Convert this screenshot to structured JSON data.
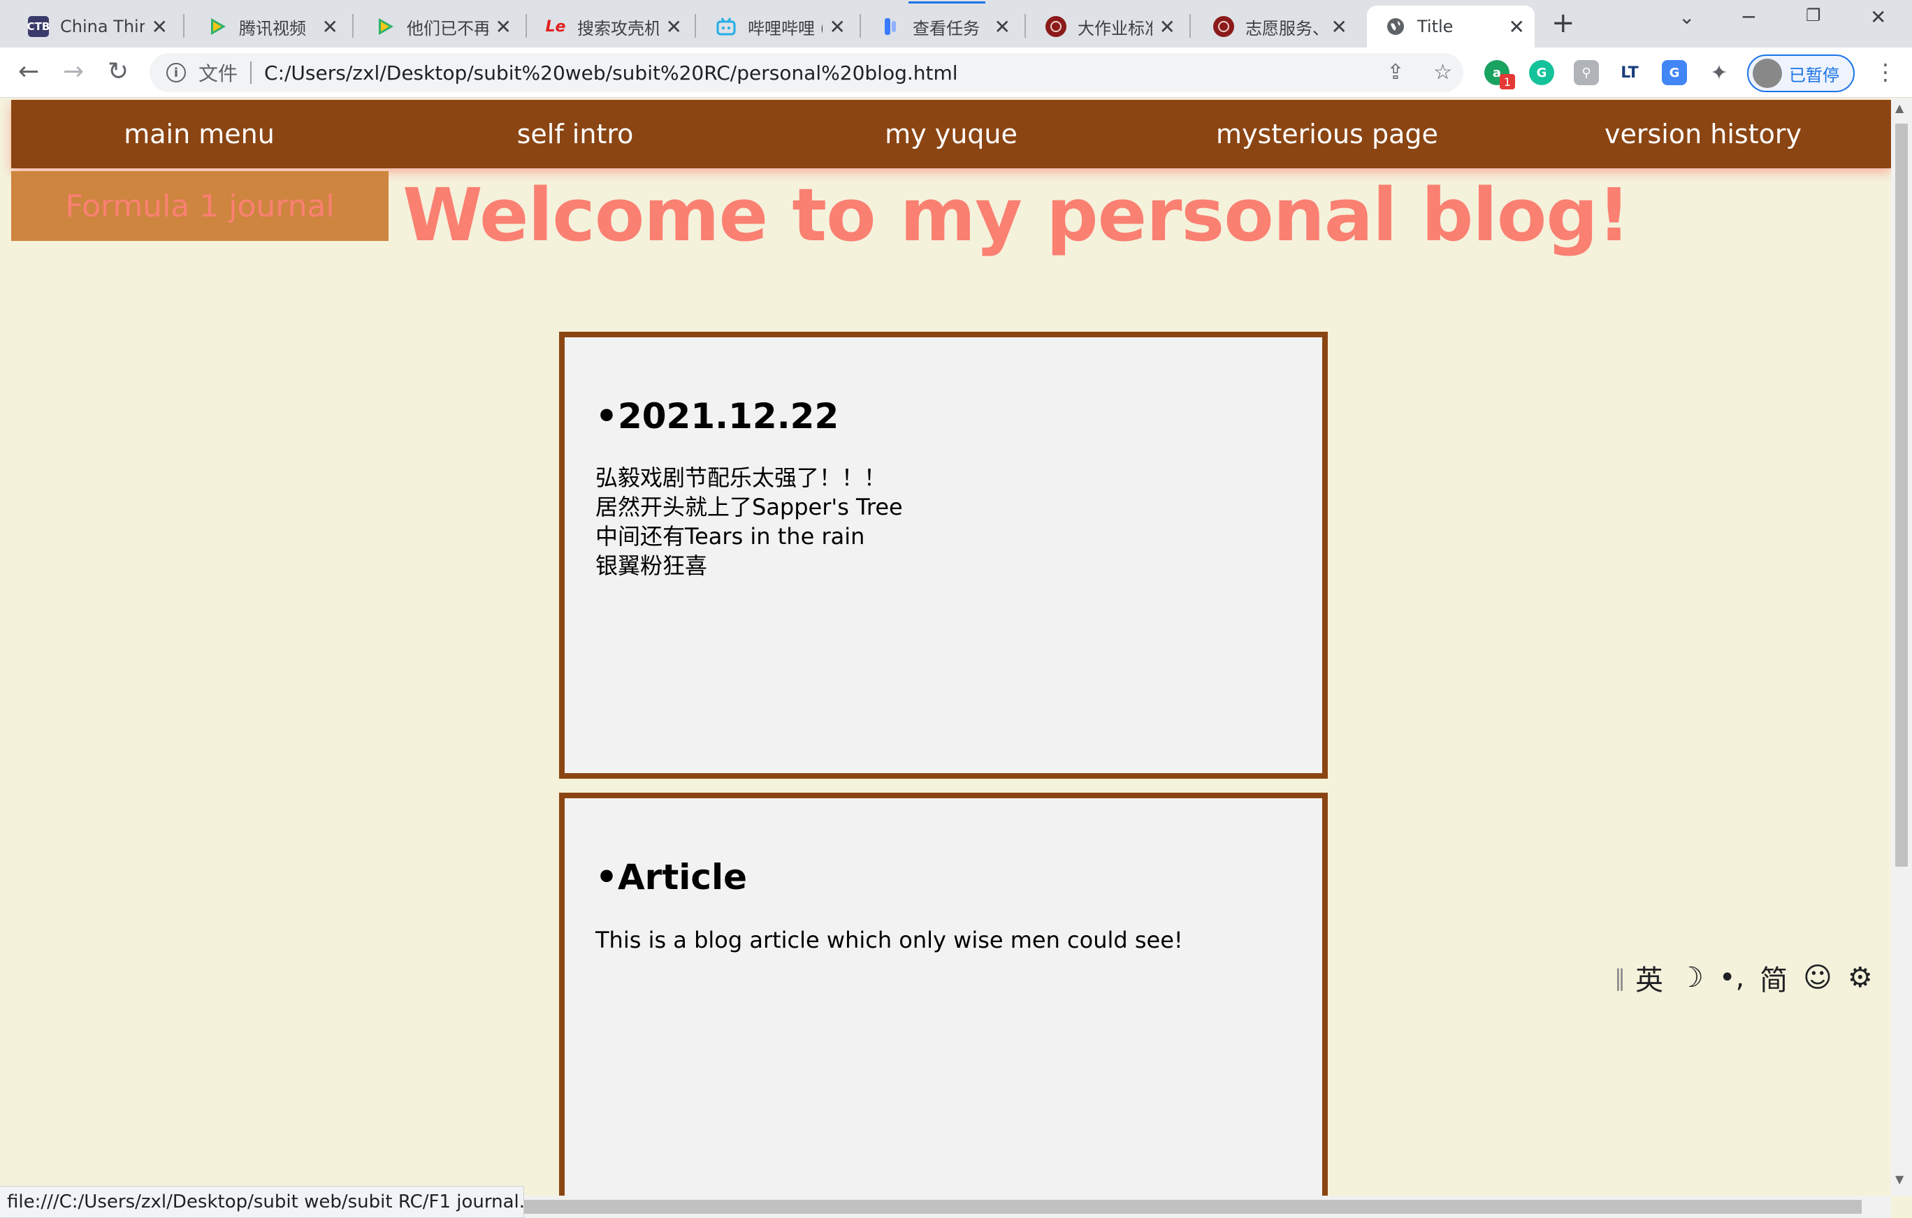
{
  "browser": {
    "tabs": [
      {
        "title": "China Thir",
        "favicon": "ctb-icon",
        "favicon_text": "CTB",
        "favicon_color": "#3a3a6a"
      },
      {
        "title": "腾讯视频",
        "favicon": "tencent-video-icon",
        "favicon_color": "#2fb36b"
      },
      {
        "title": "他们已不再",
        "favicon": "tencent-video-icon",
        "favicon_color": "#2fb36b"
      },
      {
        "title": "搜索攻壳机",
        "favicon": "le-icon",
        "favicon_text": "Le",
        "favicon_color": "#e02020"
      },
      {
        "title": "哔哩哔哩 (",
        "favicon": "bilibili-icon",
        "favicon_color": "#23ade5"
      },
      {
        "title": "查看任务",
        "favicon": "task-icon",
        "favicon_color": "#3a7afe"
      },
      {
        "title": "大作业标准",
        "favicon": "university-seal-icon",
        "favicon_color": "#8b1a1a"
      },
      {
        "title": "志愿服务、",
        "favicon": "university-seal-icon",
        "favicon_color": "#8b1a1a"
      },
      {
        "title": "Title",
        "favicon": "globe-icon",
        "favicon_color": "#5f6368",
        "active": true
      }
    ],
    "address": {
      "file_label": "文件",
      "url": "C:/Users/zxl/Desktop/subit%20web/subit%20RC/personal%20blog.html"
    },
    "profile_label": "已暂停",
    "status_url": "file:///C:/Users/zxl/Desktop/subit web/subit RC/F1 journal.html"
  },
  "page": {
    "nav": [
      "main menu",
      "self intro",
      "my yuque",
      "mysterious page",
      "version history"
    ],
    "side_button": "Formula 1 journal",
    "welcome": "Welcome to my personal blog!",
    "posts": [
      {
        "title": "•2021.12.22",
        "lines": [
          "弘毅戏剧节配乐太强了！！！",
          "居然开头就上了Sapper's Tree",
          "中间还有Tears in the rain",
          "银翼粉狂喜"
        ]
      },
      {
        "title": "•Article",
        "lines": [
          "This is a blog article which only wise men could see!"
        ]
      }
    ],
    "colors": {
      "nav_bg": "#8b4513",
      "accent": "#fa8072",
      "side_bg": "#cd853f",
      "page_bg": "#f5f2dc"
    }
  },
  "ime": {
    "lang": "英",
    "punct": "•,",
    "script": "简"
  }
}
